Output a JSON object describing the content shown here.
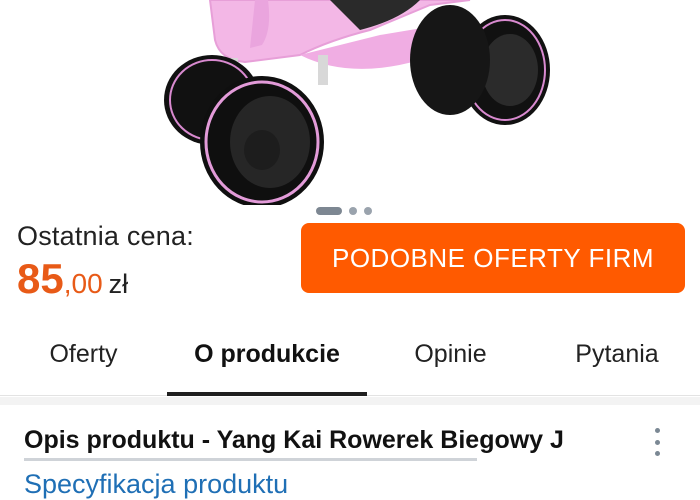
{
  "product_image": {
    "alt_subject": "balance-bike-image"
  },
  "price": {
    "label": "Ostatnia cena:",
    "integer": "85",
    "decimal": ",00",
    "currency": "zł",
    "accent_color": "#e85a17"
  },
  "similar_offers_button": {
    "label": "PODOBNE OFERTY FIRM",
    "color": "#ff5a00"
  },
  "tabs": [
    {
      "label": "Oferty",
      "active": false
    },
    {
      "label": "O produkcie",
      "active": true
    },
    {
      "label": "Opinie",
      "active": false
    },
    {
      "label": "Pytania",
      "active": false
    }
  ],
  "carousel": {
    "count": 3,
    "active_index": 0
  },
  "description": {
    "title": "Opis produktu - Yang Kai Rowerek Biegowy J",
    "spec_link": "Specyfikacja produktu",
    "menu_icon": "more-vertical-icon"
  }
}
